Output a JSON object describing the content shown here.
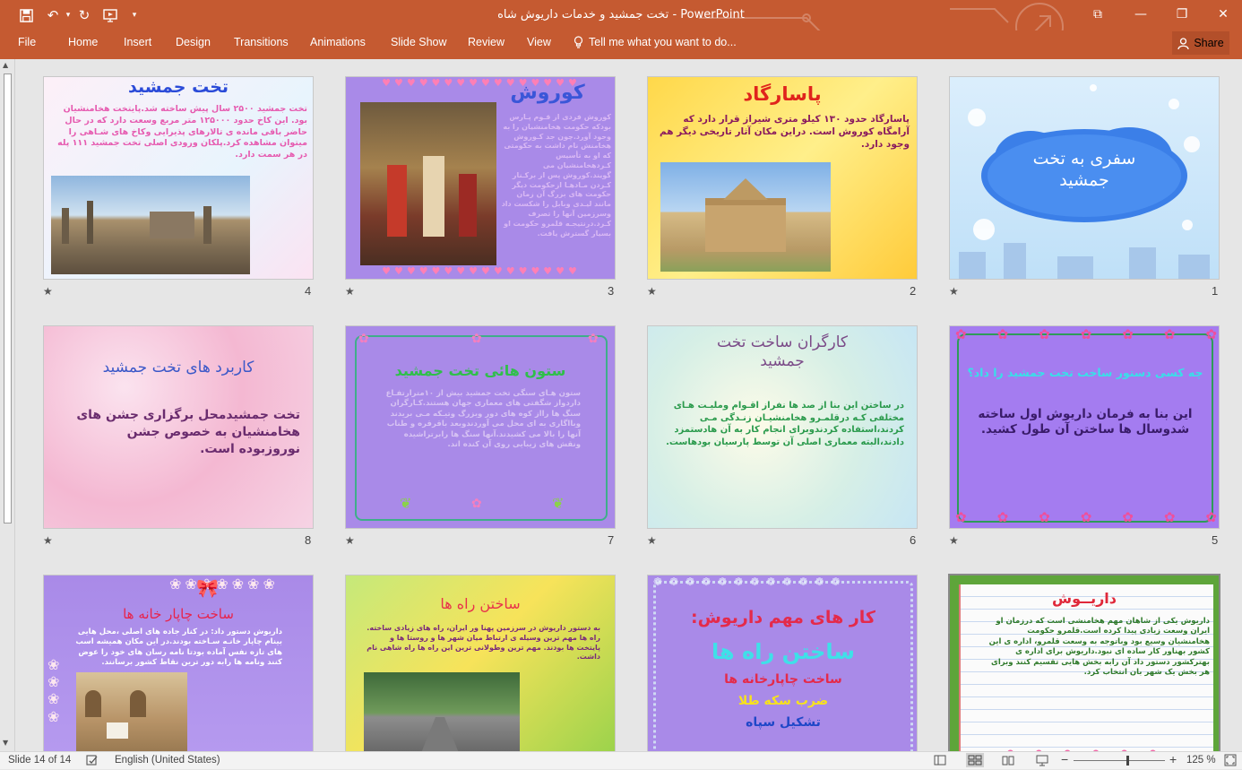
{
  "window": {
    "title": "تخت جمشید و خدمات داریوش شاه  -  PowerPoint",
    "qat_undo": "↶",
    "qat_redo": "↻",
    "qat_more": "▾",
    "restore_glyph": "⧉",
    "min_glyph": "—",
    "max_glyph": "❐",
    "close_glyph": "✕"
  },
  "ribbon": {
    "tabs": [
      "File",
      "Home",
      "Insert",
      "Design",
      "Transitions",
      "Animations",
      "Slide Show",
      "Review",
      "View"
    ],
    "tell_me": "Tell me what you want to do...",
    "share": "Share"
  },
  "slides": [
    {
      "num": "1",
      "star": "★",
      "title": "سفری به تخت\nجمشید"
    },
    {
      "num": "2",
      "star": "★",
      "title": "پاسارگاد",
      "body": "پاسارگاد حدود ۱۳۰ کیلو متری شیراز قرار دارد که آرامگاه کوروش است. دراین مکان آثار تاریخی دیگر هم وجود دارد."
    },
    {
      "num": "3",
      "star": "★",
      "title": "کوروش",
      "body": "کوروش فردی از قـوم پـارس بودکه حکومت هخامنشیان را به وجود آورد.چون جد کـوروش هخامنش نام داشت به حکومتی که او به تأسیس کـردهخامنشیان می گویند.کوروش پس از برکـنار کـردن مـادهـا ازحکومت دیگر حکومت های بزرگ آن زمان مانند لیـدی وبابل را شکست داد وسرزمین آنها را تصرف کـرد.درنتیجـه قلمرو حکومت او بسیار گسترش یافت."
    },
    {
      "num": "4",
      "star": "★",
      "title": "تخت جمشید",
      "body": "تخت جمشید ۲۵۰۰ سال پیش ساخته شد.پایتخت هخامنشیان بود. این کاخ حدود ۱۲۵۰۰۰ متر مربع وسعت دارد که در حال حاضر باقی مانده ی تالارهای پذیرایی وکاخ های شـاهی را میتوان مشاهده کرد.پلکان ورودی اصلی تخت جمشید ۱۱۱ پله در هر سمت دارد."
    },
    {
      "num": "5",
      "star": "★",
      "title": "چه کسی دستور ساخت تخت جمشید را داد؟",
      "body": "این بنا به فرمان داریوش اول ساخته شدوسال ها ساختن آن طول کشید."
    },
    {
      "num": "6",
      "star": "★",
      "title": "کارگران ساخت تخت\nجمشید",
      "body": "در ساختن این بنا از صد ها نفراز اقـوام وملیـت هـای مختلفی کـه درقلمـرو هخامنشیـان زنـدگی مـی کردند،استفاده کردندوبرای انجام کار به آن هادستمزد دادند،البته معماری اصلی آن توسط پارسیان بودهاست."
    },
    {
      "num": "7",
      "star": "★",
      "title": "ستون هائی تخت جمشید",
      "body": "ستون هـای سنگی تخت جمشید بیش از ۱۰مترارتفـاع داردواز شگفتی های معماری جهان هستند.کـارگران سنگ ها رااز کوه های دور وبزرگ وتیـکه مـی بریدند وبااگاری به ای محل می آوردندوبعد باقرقره و طناب آنها را بالا می کشیدند.آنها سنگ ها رابرتراشیده ونقش های زیبایی روی آن کنده اند."
    },
    {
      "num": "8",
      "star": "★",
      "title": "کاربرد های تخت جمشید",
      "body": "تخت جمشیدمحل برگزاری جشن های هخامنشیان به خصوص جشن نوروزبوده است."
    },
    {
      "title": "داریــوش",
      "body": "داریوش یکی از شاهان مهم هخامنشی است که درزمان او ایران وسعت زیادی پیدا کرده است.قلمرو حکومت هخامنشیان وسیع بود وباتوجه به وسعت قلمرو، اداره ی این کشور بهناور کار ساده ای نبود.داریوش برای اداره ی بهترکشور دستور داد آن رابه بخش هایی تقسیم کنند وبرای هر بخش یک شهر بان انتخاب کرد."
    },
    {
      "title": "کار های مهم داریوش:",
      "l1": "ساختن راه ها",
      "l2": "ساخت چاپارخانه ها",
      "l3": "ضرب سکه طلا",
      "l4": "تشکیل سپاه"
    },
    {
      "title": "ساختن راه ها",
      "body": "به دستور داریوش در سرزمین پهنا ور ایران، راه های زیادی ساخته. راه ها مهم ترین وسیله ی ارتباط میان شهر ها و روستا ها و پایتخت ها بودند. مهم ترین وطولانی ترین این راه ها راه شاهی نام داشت."
    },
    {
      "title": "ساخت چاپار خانه ها",
      "body": "داریوش دستور داد: در کنار جاده های اصلی ،محل هایی بینام چاپار خانـه سـاخته بودند.در این مکان همیشه اسب های تازه نفس آماده بودتا نامه رسان های خود را عوض کنند ونامه ها رابه دور ترین نقاط کشور برسانند."
    }
  ],
  "status": {
    "slide_of": "Slide 14 of 14",
    "language": "English (United States)",
    "zoom": "125 %",
    "zoom_minus": "−",
    "zoom_plus": "+"
  }
}
